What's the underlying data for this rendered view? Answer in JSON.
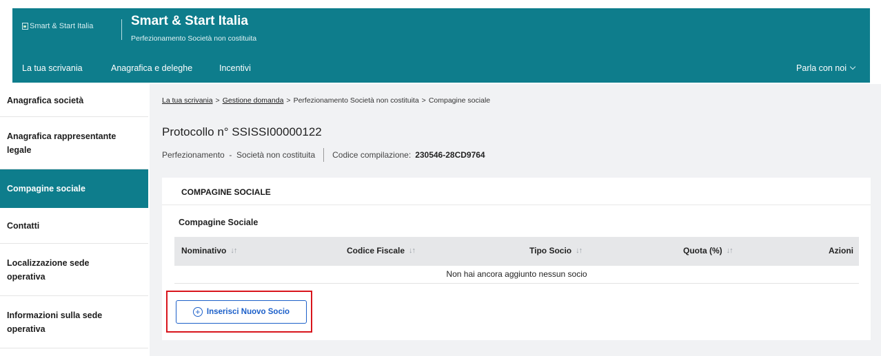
{
  "header": {
    "logo_alt": "Smart & Start Italia",
    "title": "Smart & Start Italia",
    "subtitle": "Perfezionamento Società non costituita",
    "nav": [
      {
        "label": "La tua scrivania"
      },
      {
        "label": "Anagrafica e deleghe"
      },
      {
        "label": "Incentivi"
      }
    ],
    "contact_label": "Parla con noi"
  },
  "sidebar": {
    "items": [
      {
        "label": "Anagrafica società",
        "active": false
      },
      {
        "label": "Anagrafica rappresentante legale",
        "active": false
      },
      {
        "label": "Compagine sociale",
        "active": true
      },
      {
        "label": "Contatti",
        "active": false
      },
      {
        "label": "Localizzazione sede operativa",
        "active": false
      },
      {
        "label": "Informazioni sulla sede operativa",
        "active": false
      }
    ]
  },
  "breadcrumb": {
    "items": [
      {
        "label": "La tua scrivania",
        "link": true
      },
      {
        "label": "Gestione domanda",
        "link": true
      },
      {
        "label": "Perfezionamento Società non costituita",
        "link": false
      },
      {
        "label": "Compagine sociale",
        "link": false
      }
    ],
    "separator": ">"
  },
  "protocol": {
    "title": "Protocollo n° SSISSI00000122",
    "type": "Perfezionamento  -  Società non costituita",
    "code_label": "Codice compilazione:",
    "code_value": "230546-28CD9764"
  },
  "card": {
    "title": "COMPAGINE SOCIALE",
    "section_label": "Compagine Sociale",
    "columns": [
      {
        "label": "Nominativo",
        "sortable": true
      },
      {
        "label": "Codice Fiscale",
        "sortable": true
      },
      {
        "label": "Tipo Socio",
        "sortable": true
      },
      {
        "label": "Quota (%)",
        "sortable": true
      },
      {
        "label": "Azioni",
        "sortable": false
      }
    ],
    "sort_icon": "↓↑",
    "empty_message": "Non hai ancora aggiunto nessun socio",
    "add_button_label": "Inserisci Nuovo Socio"
  },
  "colors": {
    "brand": "#0e7d8c",
    "button": "#1b5fc9",
    "highlight": "#d8141b"
  }
}
